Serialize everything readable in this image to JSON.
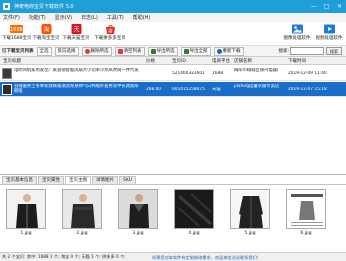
{
  "window": {
    "title": "神奇电商宝贝下载软件 3.0",
    "controls": [
      "—",
      "□",
      "✕"
    ]
  },
  "menu": [
    "文件(F)",
    "功能(T)",
    "显示(V)",
    "日志(L)",
    "工具(T)",
    "帮助(H)"
  ],
  "toolbar": {
    "items": [
      {
        "label": "下载1688宝贝",
        "icon": "1688-icon",
        "badge": "1688",
        "color": "#ff6a00"
      },
      {
        "label": "下载淘宝宝贝",
        "icon": "taobao-icon",
        "badge": "淘",
        "color": "#ff5000"
      },
      {
        "label": "下载天猫宝贝",
        "icon": "tmall-icon",
        "badge": "天",
        "color": "#e0141e"
      },
      {
        "label": "下载拼多多宝贝",
        "icon": "pdd-icon",
        "badge": "拼",
        "color": "#e02e24"
      }
    ],
    "right_items": [
      {
        "label": "图像处理软件",
        "icon": "image-tool-icon",
        "color": "#1c7cd5"
      },
      {
        "label": "视频处理软件",
        "icon": "video-tool-icon",
        "color": "#1c7cd5"
      }
    ]
  },
  "actions": {
    "section_label": "已下载宝贝列表",
    "buttons": [
      {
        "label": "全选",
        "icon": "",
        "color": ""
      },
      {
        "label": "反向选择",
        "icon": "",
        "color": ""
      },
      {
        "label": "删除所选",
        "icon": "delete-icon",
        "color": "#e53935"
      },
      {
        "label": "清空列表",
        "icon": "clear-icon",
        "color": "#e53935"
      },
      {
        "label": "导出所选",
        "icon": "export-icon",
        "color": "#2e7d32"
      },
      {
        "label": "导出全部",
        "icon": "export-all-icon",
        "color": "#2e7d32"
      },
      {
        "label": "重新下载",
        "icon": "refresh-icon",
        "color": "#1565c0"
      }
    ],
    "search_label": "搜索:",
    "search_value": "",
    "search_button": "搜索"
  },
  "grid": {
    "columns": [
      "宝贝标题",
      "价格",
      "宝贝ID",
      "电商平台",
      "店铺名称",
      "下载时间"
    ],
    "rows": [
      {
        "title": "电吹风机家用发型厂家直销智能风扇大小功率冷热风吹筒一件代发",
        "price": "",
        "id": "521400322601",
        "platform": "1688",
        "shop": "揭阳市榕城区锦兴电器厂",
        "time": "2019-12-09 11:40",
        "selected": false
      },
      {
        "title": "羽绒服男士冬季新款韩版潮流修身帅气白鸭绒外套男装中长款加厚韩版",
        "price": "268.00",
        "id": "601415258075",
        "platform": "天猫",
        "shop": "plaforg度量衣服专卖店",
        "time": "2019-12-07 15:18",
        "selected": true
      }
    ]
  },
  "detail_tabs": [
    {
      "label": "宝贝基本信息",
      "active": false
    },
    {
      "label": "宝贝属性",
      "active": false
    },
    {
      "label": "宝贝主图",
      "active": true
    },
    {
      "label": "详情图片",
      "active": false
    },
    {
      "label": "SKU",
      "active": false
    }
  ],
  "images": [
    "1.jpg",
    "2.jpg",
    "3.jpg",
    "4.jpg",
    "5.jpg",
    "6.jpg"
  ],
  "status": {
    "text": "共 2 个宝贝: 其中: 1688 1 个; 淘宝 0 个; 天猫 1 个; 拼多多 0 个;",
    "hint": "如果您对本软件有定制修改需求，欢迎来信洽谈联系我们！"
  }
}
